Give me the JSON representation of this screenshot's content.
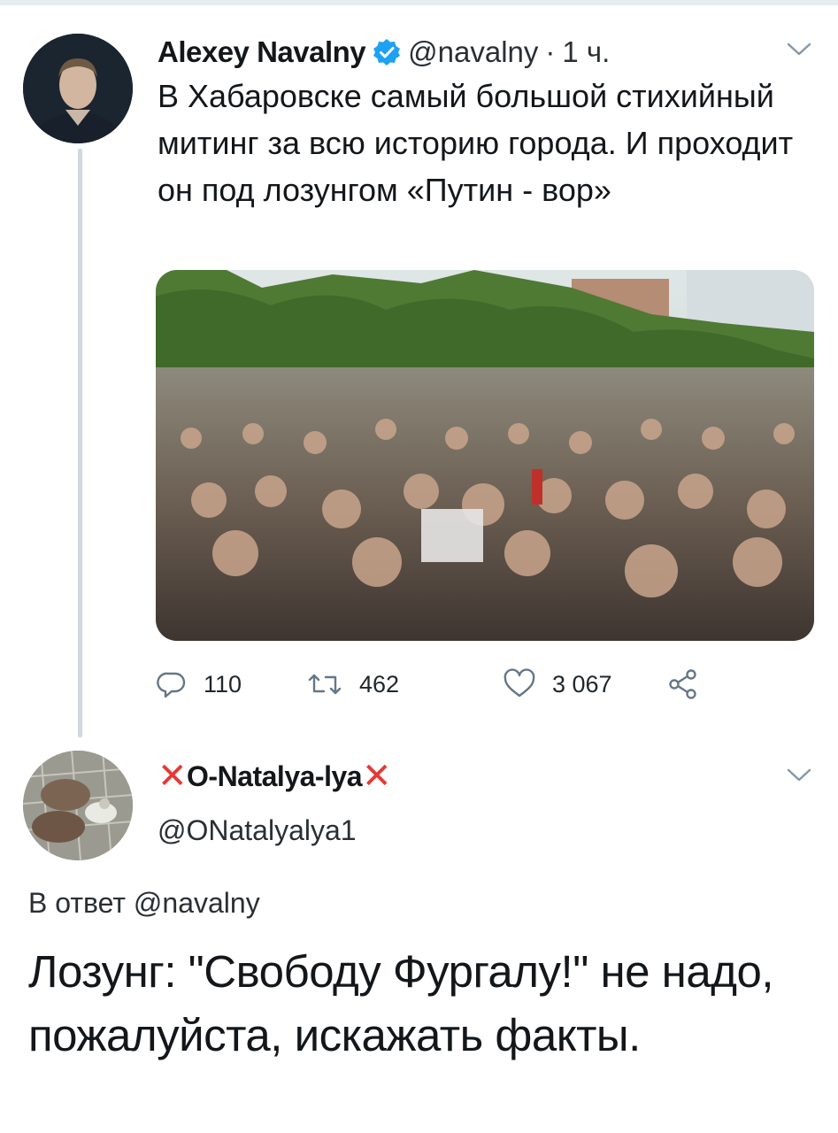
{
  "tweet": {
    "author_name": "Alexey Navalny",
    "handle": "@navalny",
    "separator": "·",
    "time": "1 ч.",
    "text": "В Хабаровске самый большой стихийный митинг за всю историю города. И проходит он под лозунгом «Путин - вор»",
    "media": {
      "description": "crowd-rally-photo"
    },
    "actions": {
      "reply_count": "110",
      "retweet_count": "462",
      "like_count": "3 067"
    },
    "icons": [
      "verified-icon",
      "chevron-down-icon",
      "reply-icon",
      "retweet-icon",
      "like-icon",
      "share-icon"
    ]
  },
  "reply": {
    "author_name": "O-Natalya-lya",
    "name_decoration": "✕",
    "handle": "@ONatalyalya1",
    "replying_to": "В ответ @navalny",
    "text": "Лозунг: \"Свободу Фургалу!\" не надо, пожалуйста, искажать факты."
  },
  "colors": {
    "verified": "#1da1f2",
    "decoration": "#e53935",
    "icon": "#657786"
  }
}
